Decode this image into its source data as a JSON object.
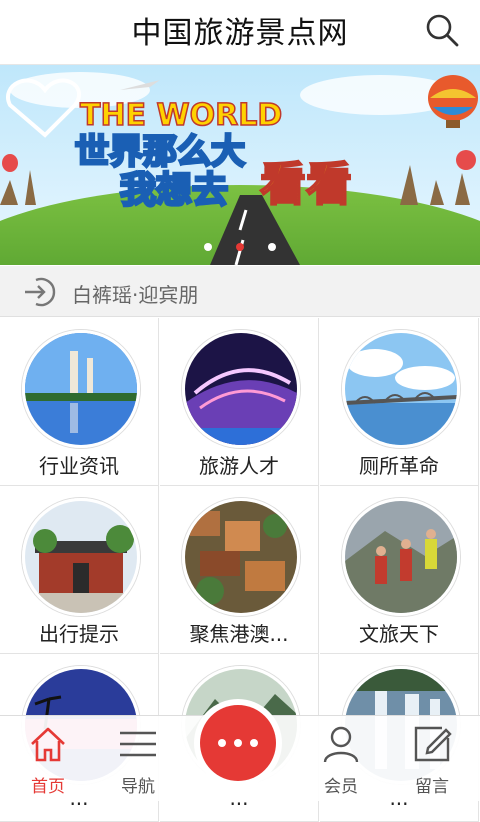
{
  "header": {
    "title": "中国旅游景点网"
  },
  "banner": {
    "line1": "THE WORLD",
    "line2": "世界那么大",
    "line3": "我想去",
    "line4": "看看",
    "dots": 3,
    "active_dot": 2
  },
  "notice": {
    "text": "白裤瑶·迎宾朋"
  },
  "grid": [
    {
      "label": "行业资讯"
    },
    {
      "label": "旅游人才"
    },
    {
      "label": "厕所革命"
    },
    {
      "label": "出行提示"
    },
    {
      "label": "聚焦港澳..."
    },
    {
      "label": "文旅天下"
    },
    {
      "label": "..."
    },
    {
      "label": "..."
    },
    {
      "label": "..."
    }
  ],
  "tabbar": {
    "home": "首页",
    "nav": "导航",
    "member": "会员",
    "message": "留言"
  },
  "colors": {
    "accent": "#e53935"
  }
}
